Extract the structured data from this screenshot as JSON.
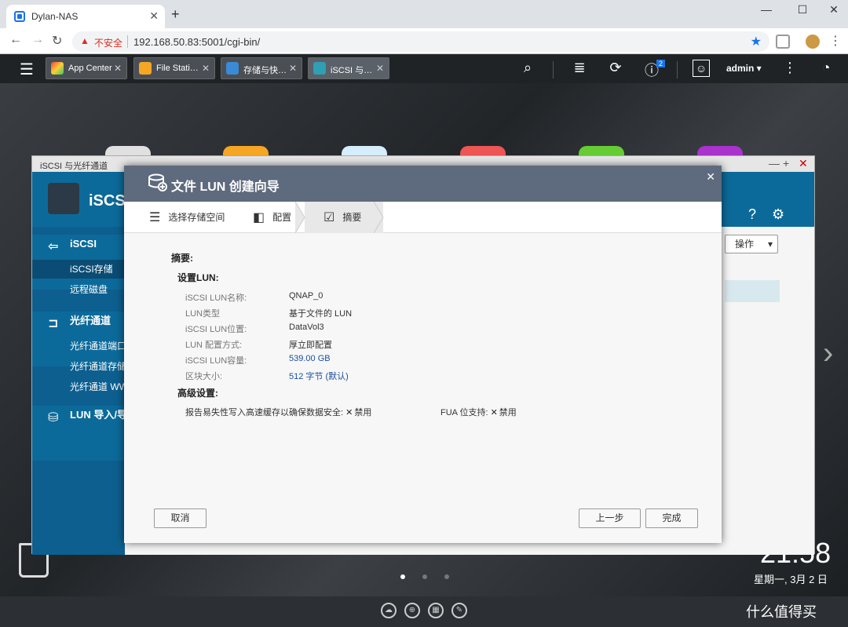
{
  "browser": {
    "tab_title": "Dylan-NAS",
    "new_tab": "+",
    "min": "—",
    "max": "☐",
    "close": "✕",
    "insecure_label": "不安全",
    "url": "192.168.50.83:5001/cgi-bin/"
  },
  "qnap_bar": {
    "tabs": [
      {
        "label": "App Center",
        "color": "#e8b323"
      },
      {
        "label": "File Stati…",
        "color": "#f5a623"
      },
      {
        "label": "存储与快…",
        "color": "#3a8ad6"
      },
      {
        "label": "iSCSI 与…",
        "color": "#2f9fb3"
      }
    ],
    "notification_count": "2",
    "user": "admin ▾"
  },
  "iscsi_window": {
    "title": "iSCSI 与光纤通道",
    "app_title": "iSCSI",
    "op_button": "操作",
    "sidebar": [
      {
        "label": "iSCSI",
        "type": "head",
        "icon": "⇦"
      },
      {
        "label": "iSCSI存储",
        "type": "item",
        "active": true
      },
      {
        "label": "远程磁盘",
        "type": "item"
      },
      {
        "label": "光纤通道",
        "type": "head",
        "icon": "⊐"
      },
      {
        "label": "光纤通道端口",
        "type": "item"
      },
      {
        "label": "光纤通道存储",
        "type": "item"
      },
      {
        "label": "光纤通道 WWPN",
        "type": "item"
      },
      {
        "label": "LUN 导入/导出",
        "type": "head",
        "icon": "⛁"
      }
    ]
  },
  "wizard": {
    "title": "文件 LUN 创建向导",
    "steps": [
      "选择存储空间",
      "配置",
      "摘要"
    ],
    "summary_title": "摘要:",
    "lun_section": "设置LUN:",
    "fields": [
      {
        "key": "iSCSI LUN名称:",
        "value": "QNAP_0",
        "blue": false
      },
      {
        "key": "LUN类型",
        "value": "基于文件的 LUN",
        "blue": false
      },
      {
        "key": "iSCSI LUN位置:",
        "value": "DataVol3",
        "blue": false
      },
      {
        "key": "LUN 配置方式:",
        "value": "厚立即配置",
        "blue": false
      },
      {
        "key": "iSCSI LUN容量:",
        "value": "539.00 GB",
        "blue": true
      },
      {
        "key": "区块大小:",
        "value": "512 字节 (默认)",
        "blue": true
      }
    ],
    "advanced_section": "高级设置:",
    "advanced": [
      {
        "label": "报告易失性写入高速缓存以确保数据安全:",
        "value": "禁用"
      },
      {
        "label": "FUA 位支持:",
        "value": "禁用"
      }
    ],
    "buttons": {
      "cancel": "取消",
      "back": "上一步",
      "finish": "完成"
    }
  },
  "desktop": {
    "clock": "21:58",
    "date": "星期一, 3月 2 日"
  },
  "watermark": "什么值得买"
}
